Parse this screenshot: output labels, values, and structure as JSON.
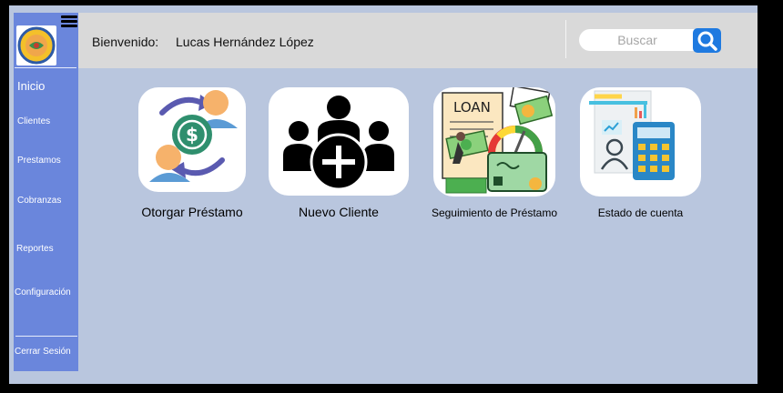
{
  "header": {
    "welcome_label": "Bienvenido:",
    "user_name": "Lucas Hernández López",
    "search_placeholder": "Buscar"
  },
  "sidebar": {
    "items": [
      {
        "label": "Inicio"
      },
      {
        "label": "Clientes"
      },
      {
        "label": "Prestamos"
      },
      {
        "label": "Cobranzas"
      },
      {
        "label": "Reportes"
      },
      {
        "label": "Configuración"
      },
      {
        "label": "Cerrar Sesión"
      }
    ]
  },
  "cards": [
    {
      "label": "Otorgar Préstamo",
      "icon": "loan-exchange-icon"
    },
    {
      "label": "Nuevo Cliente",
      "icon": "add-client-icon"
    },
    {
      "label": "Seguimiento de Préstamo",
      "icon": "loan-tracking-icon",
      "image_text": "LOAN"
    },
    {
      "label": "Estado de cuenta",
      "icon": "account-statement-icon"
    }
  ],
  "colors": {
    "sidebar": "#6a86dc",
    "content_bg": "#b9c6de",
    "header_bg": "#d9d9d9",
    "search_button": "#1f7ae0"
  }
}
